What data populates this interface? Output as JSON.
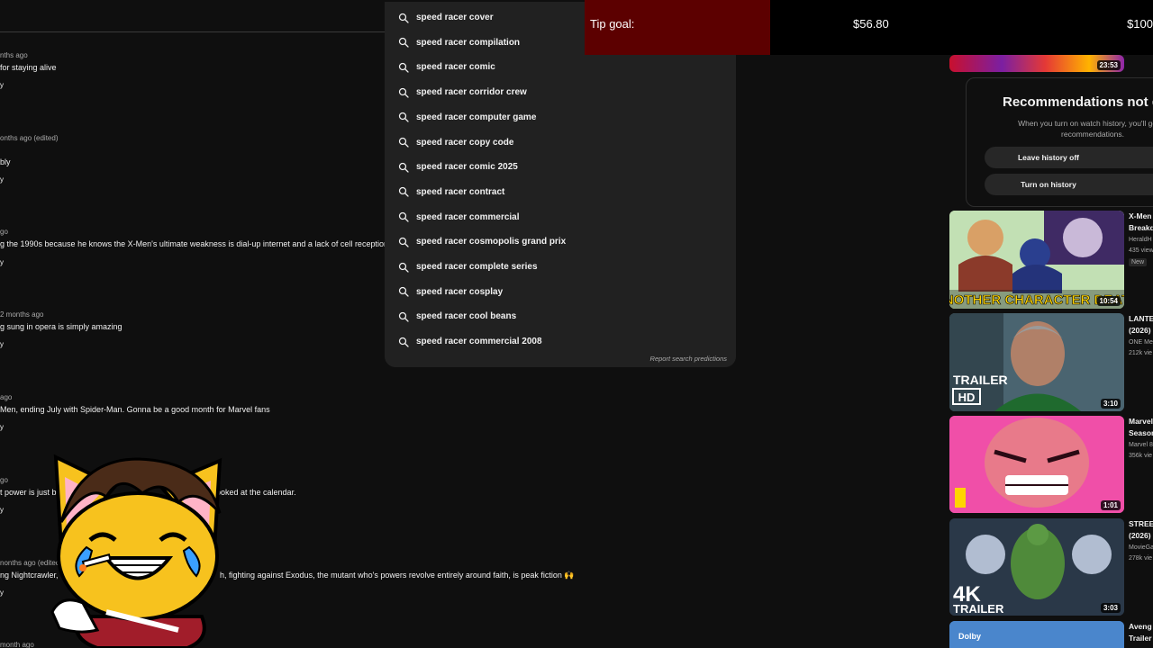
{
  "comments": [
    {
      "meta": "nths ago",
      "text": "for staying alive",
      "reply": "y"
    },
    {
      "meta": "onths ago (edited)",
      "text": "bly",
      "reply": "y"
    },
    {
      "meta": "go",
      "text": "g the 1990s because he knows the X-Men's ultimate weakness is dial-up internet and a lack of cell reception",
      "reply": "y"
    },
    {
      "meta": "2 months ago",
      "text": "g sung in opera is simply amazing",
      "reply": "y"
    },
    {
      "meta": "ago",
      "text": "Men, ending July with Spider-Man. Gonna be a good month for Marvel fans",
      "reply": "y"
    },
    {
      "meta": "go",
      "text": "t power is just b",
      "text2": "ooked at the calendar.",
      "reply": "y"
    },
    {
      "meta": "nonths ago (edited)",
      "text": "ng Nightcrawler,",
      "text2": "h, fighting against Exodus, the mutant who's powers revolve entirely around faith, is peak fiction 🙌",
      "reply": "y"
    },
    {
      "meta": "month ago"
    }
  ],
  "suggestions": [
    "speed racer cover",
    "speed racer compilation",
    "speed racer comic",
    "speed racer corridor crew",
    "speed racer computer game",
    "speed racer copy code",
    "speed racer comic 2025",
    "speed racer contract",
    "speed racer commercial",
    "speed racer cosmopolis grand prix",
    "speed racer complete series",
    "speed racer cosplay",
    "speed racer cool beans",
    "speed racer commercial 2008"
  ],
  "report_label": "Report search predictions",
  "tip": {
    "label": "Tip goal:",
    "current": "$56.80",
    "goal": "$100",
    "progress": 0.568,
    "fill_color": "#5c0000"
  },
  "recommendation_card": {
    "title": "Recommendations not q",
    "description": "When you turn on watch history, you'll get m recommendations.",
    "leave_button": "Leave history off",
    "turn_on_button": "Turn on history"
  },
  "videos": [
    {
      "duration": "23:53"
    },
    {
      "title1": "X-Men",
      "title2": "Breakd",
      "meta1": "HeraldH",
      "meta2": "435 view",
      "badge": "New",
      "duration": "10:54",
      "thumb_text": "ANOTHER CHARACTER DEATH"
    },
    {
      "title1": "LANTE",
      "title2": "(2026)",
      "meta1": "ONE Me",
      "meta2": "212k vie",
      "duration": "3:10",
      "thumb_text": "TRAILER",
      "thumb_text2": "HD"
    },
    {
      "title1": "Marvel",
      "title2": "Season",
      "meta1": "Marvel 8",
      "meta2": "356k vie",
      "duration": "1:01"
    },
    {
      "title1": "STREE",
      "title2": "(2026)",
      "meta1": "MovieGa",
      "meta2": "278k vie",
      "duration": "3:03",
      "thumb_text": "4K",
      "thumb_text2": "TRAILER"
    },
    {
      "title1": "Aveng",
      "title2": "Trailer",
      "thumb_text": "Dolby"
    }
  ]
}
